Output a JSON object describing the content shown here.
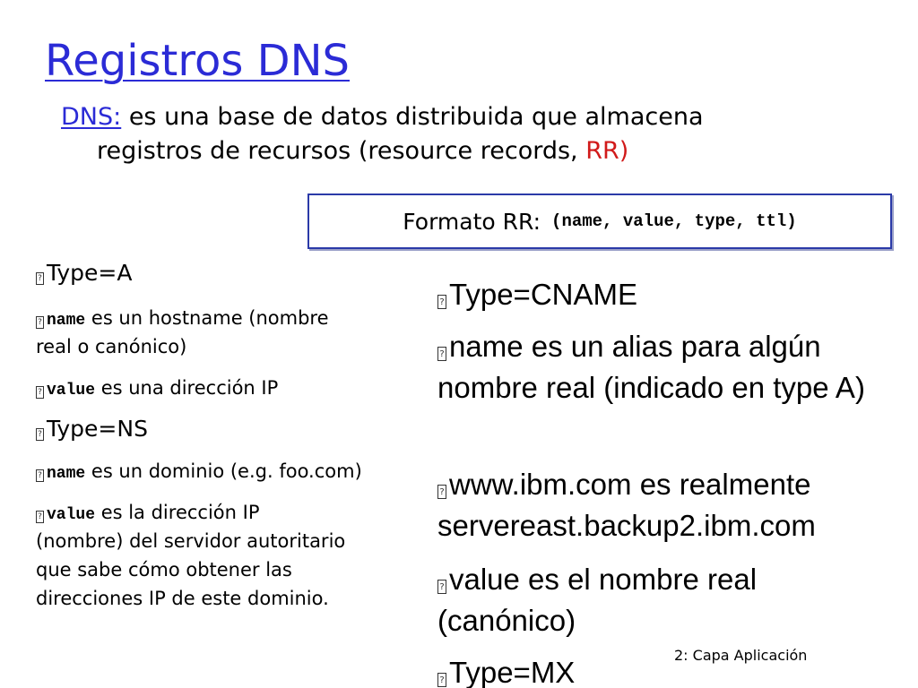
{
  "title": "Registros DNS",
  "intro": {
    "lead": "DNS:",
    "text_line1": " es una base de datos distribuida que almacena",
    "text_line2": "registros de recursos (resource records, ",
    "rr": "RR)"
  },
  "rr_format": {
    "label": "Formato RR:",
    "fields": "(name, value, type, ttl)"
  },
  "bullet_glyph": "?",
  "left": {
    "type_a": "Type=A",
    "a_name_code": "name",
    "a_name_text": " es un hostname (nombre",
    "a_name_text2": "real o canónico)",
    "a_value_code": "value",
    "a_value_text": " es una dirección IP",
    "type_ns": "Type=NS",
    "ns_name_code": "name",
    "ns_name_text": " es un dominio (e.g. foo.com)",
    "ns_value_code": "value",
    "ns_value_text": " es la dirección IP",
    "ns_value_line2": "(nombre) del servidor autoritario",
    "ns_value_line3": "que sabe cómo obtener las",
    "ns_value_line4": "direcciones IP de este dominio."
  },
  "right": {
    "type_cname": "Type=CNAME",
    "cname_name": "name es un alias para algún nombre real (indicado en type A)",
    "cname_example": "www.ibm.com es realmente servereast.backup2.ibm.com",
    "cname_value": "value es el nombre real (canónico)",
    "type_mx": "Type=MX"
  },
  "footer": "2: Capa Aplicación"
}
